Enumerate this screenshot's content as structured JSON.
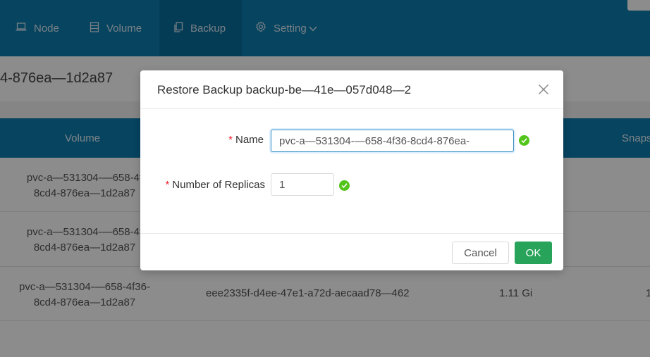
{
  "nav": {
    "items": [
      {
        "label": "Node",
        "icon": "laptop-icon"
      },
      {
        "label": "Volume",
        "icon": "database-icon"
      },
      {
        "label": "Backup",
        "icon": "copy-icon"
      },
      {
        "label": "Setting",
        "icon": "gear-icon"
      }
    ],
    "active": "Backup"
  },
  "page": {
    "title_fragment": "4-876ea—1d2a87"
  },
  "table": {
    "columns": [
      "Volume",
      "Snaps"
    ],
    "rows": [
      {
        "name_line1": "pvc-a—531304-—658-4f",
        "name_line2": "8cd4-876ea—1d2a87",
        "backup": "",
        "size": ""
      },
      {
        "name_line1": "pvc-a—531304-—658-4f",
        "name_line2": "8cd4-876ea—1d2a87",
        "backup": "",
        "size": ""
      },
      {
        "name_line1": "pvc-a—531304-—658-4f36-",
        "name_line2": "8cd4-876ea—1d2a87",
        "backup": "eee2335f-d4ee-47e1-a72d-aecaad78—462",
        "size": "1.11 Gi",
        "edge": "1"
      }
    ]
  },
  "modal": {
    "title": "Restore Backup backup-be—41e—057d048—2",
    "fields": {
      "name": {
        "label": "Name",
        "value": "pvc-a—531304-—658-4f36-8cd4-876ea-"
      },
      "replicas": {
        "label": "Number of Replicas",
        "value": "1"
      }
    },
    "required_mark": "*",
    "cancel_label": "Cancel",
    "ok_label": "OK"
  },
  "colors": {
    "nav_bg": "#0b7cb0",
    "primary_button": "#27a35a",
    "success_badge": "#52c41a",
    "required": "#f5222d"
  }
}
